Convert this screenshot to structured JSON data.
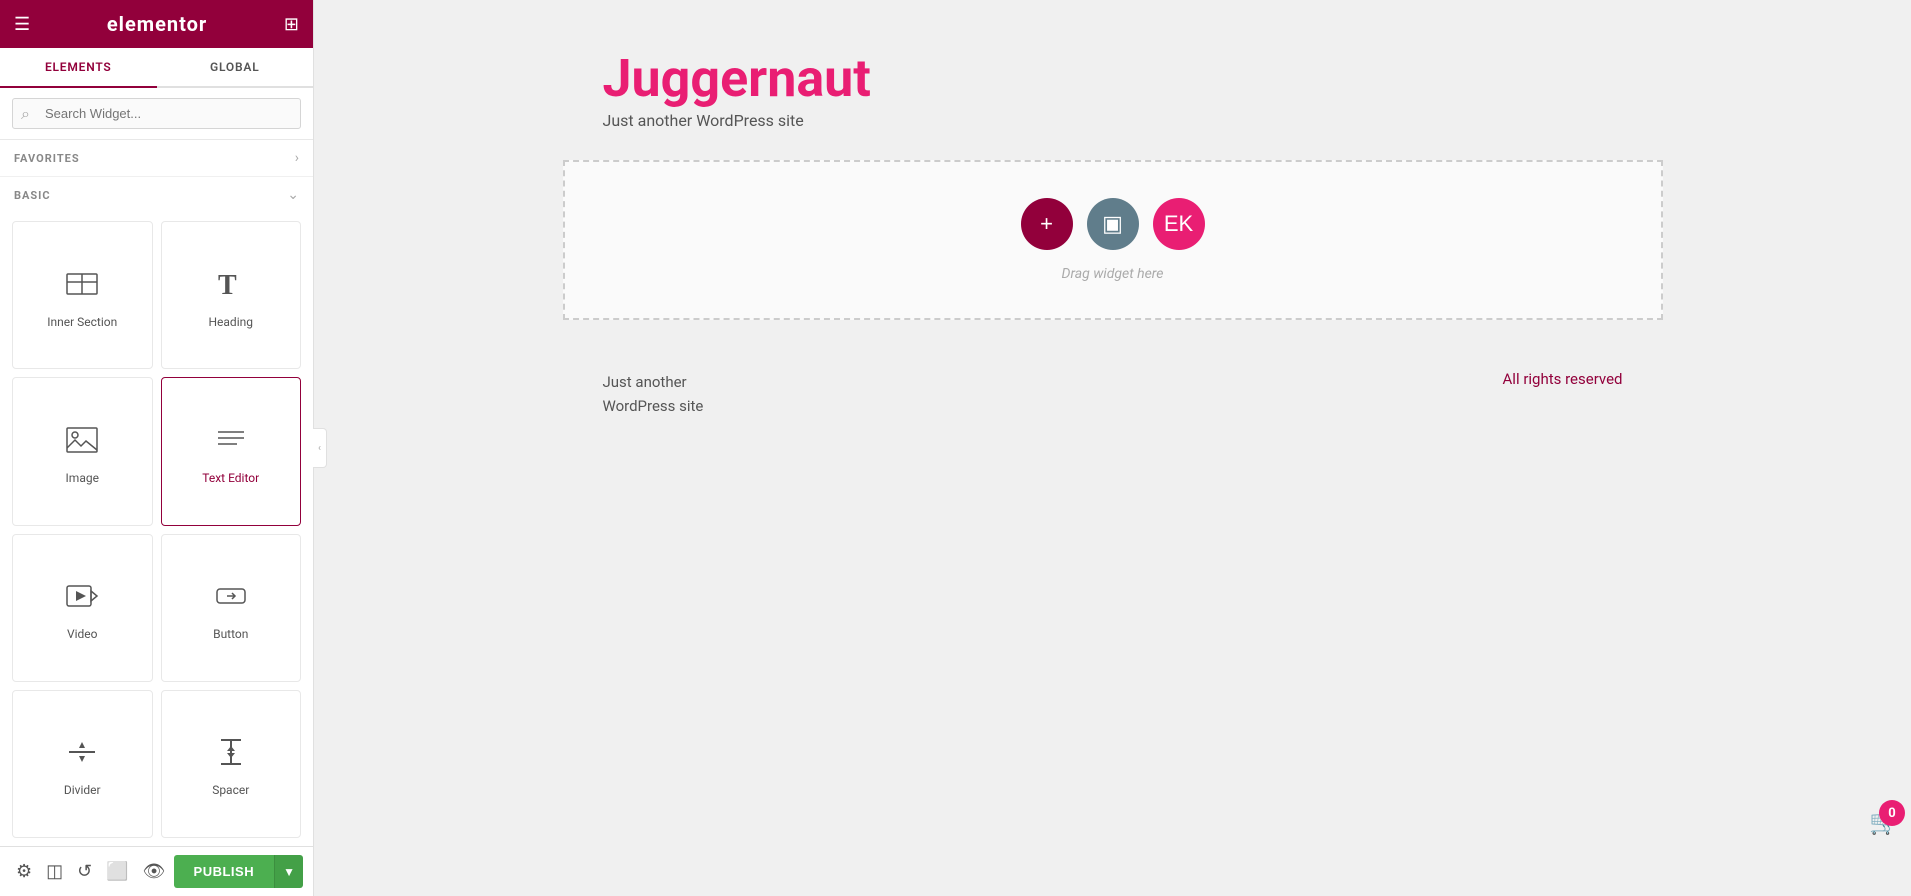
{
  "header": {
    "logo_text": "elementor",
    "hamburger_label": "☰",
    "grid_label": "⊞"
  },
  "sidebar": {
    "tabs": [
      {
        "id": "elements",
        "label": "ELEMENTS",
        "active": true
      },
      {
        "id": "global",
        "label": "GLOBAL",
        "active": false
      }
    ],
    "search_placeholder": "Search Widget...",
    "sections": [
      {
        "id": "favorites",
        "label": "FAVORITES",
        "collapsed": true
      },
      {
        "id": "basic",
        "label": "BASIC",
        "collapsed": false
      }
    ],
    "widgets": [
      {
        "id": "inner-section",
        "label": "Inner Section",
        "icon_type": "inner-section"
      },
      {
        "id": "heading",
        "label": "Heading",
        "icon_type": "heading"
      },
      {
        "id": "image",
        "label": "Image",
        "icon_type": "image"
      },
      {
        "id": "text-editor",
        "label": "Text Editor",
        "icon_type": "text-editor",
        "active": true
      },
      {
        "id": "video",
        "label": "Video",
        "icon_type": "video"
      },
      {
        "id": "button",
        "label": "Button",
        "icon_type": "button"
      },
      {
        "id": "divider",
        "label": "Divider",
        "icon_type": "divider"
      },
      {
        "id": "spacer",
        "label": "Spacer",
        "icon_type": "spacer"
      }
    ],
    "footer": {
      "publish_label": "PUBLISH",
      "arrow_label": "▼"
    }
  },
  "canvas": {
    "site_title": "Juggernaut",
    "site_tagline": "Just another WordPress site",
    "drag_text": "Drag widget here",
    "add_btn_label": "+",
    "template_btn_label": "▣",
    "elementor_btn_label": "EK"
  },
  "footer": {
    "left_line1": "Just another",
    "left_line2": "WordPress site",
    "right_text": "All rights reserved"
  },
  "cart": {
    "count": "0"
  }
}
